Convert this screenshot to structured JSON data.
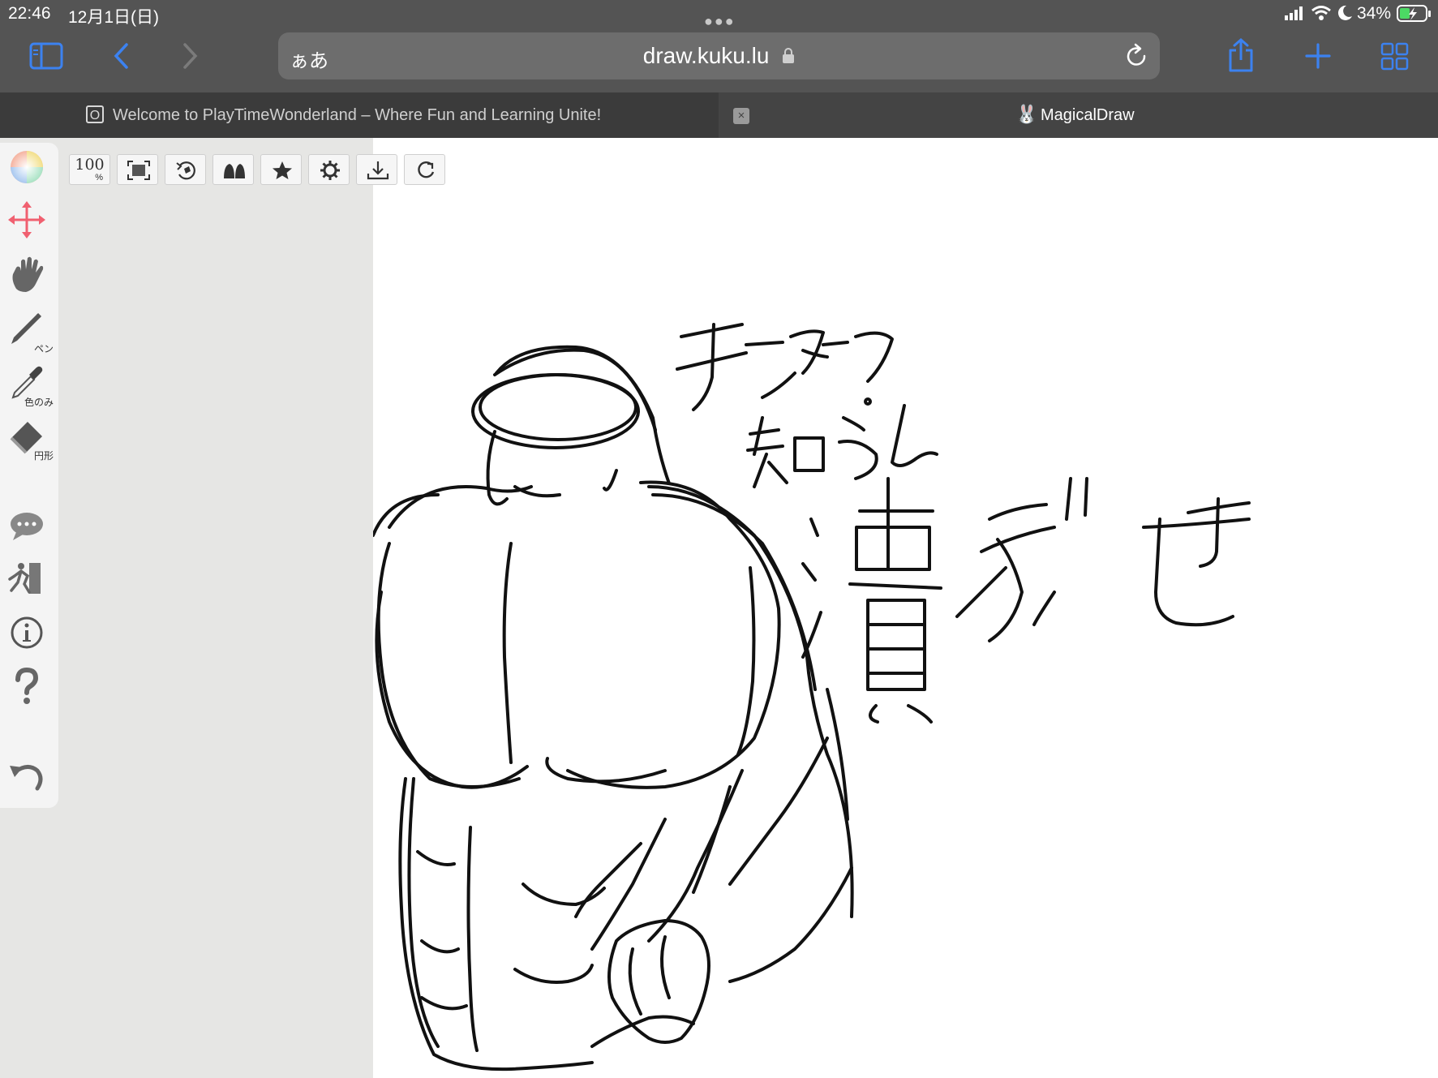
{
  "status_bar": {
    "time": "22:46",
    "date": "12月1日(日)",
    "battery": "34%"
  },
  "browser": {
    "text_size_button": "ぁあ",
    "url": "draw.kuku.lu",
    "tabs": [
      {
        "title": "Welcome to PlayTimeWonderland – Where Fun and Learning Unite!",
        "icon": "o-square-icon",
        "active": false
      },
      {
        "title": "MagicalDraw",
        "icon": "rabbit-icon",
        "active": true
      }
    ],
    "close_glyph": "×"
  },
  "toolbar": {
    "zoom_label": "100",
    "zoom_pct": "%"
  },
  "tools": {
    "pen_label": "ペン",
    "color_only_label": "色のみ",
    "circle_label": "円形"
  },
  "canvas": {
    "drawn_text_line1": "チーターァ？",
    "drawn_text_line2": "知らん",
    "drawn_text_line3": "潰せ"
  },
  "colors": {
    "accent": "#3c82f0",
    "chrome": "#545454",
    "tabbar": "#444444",
    "move_tool": "#f06070"
  }
}
